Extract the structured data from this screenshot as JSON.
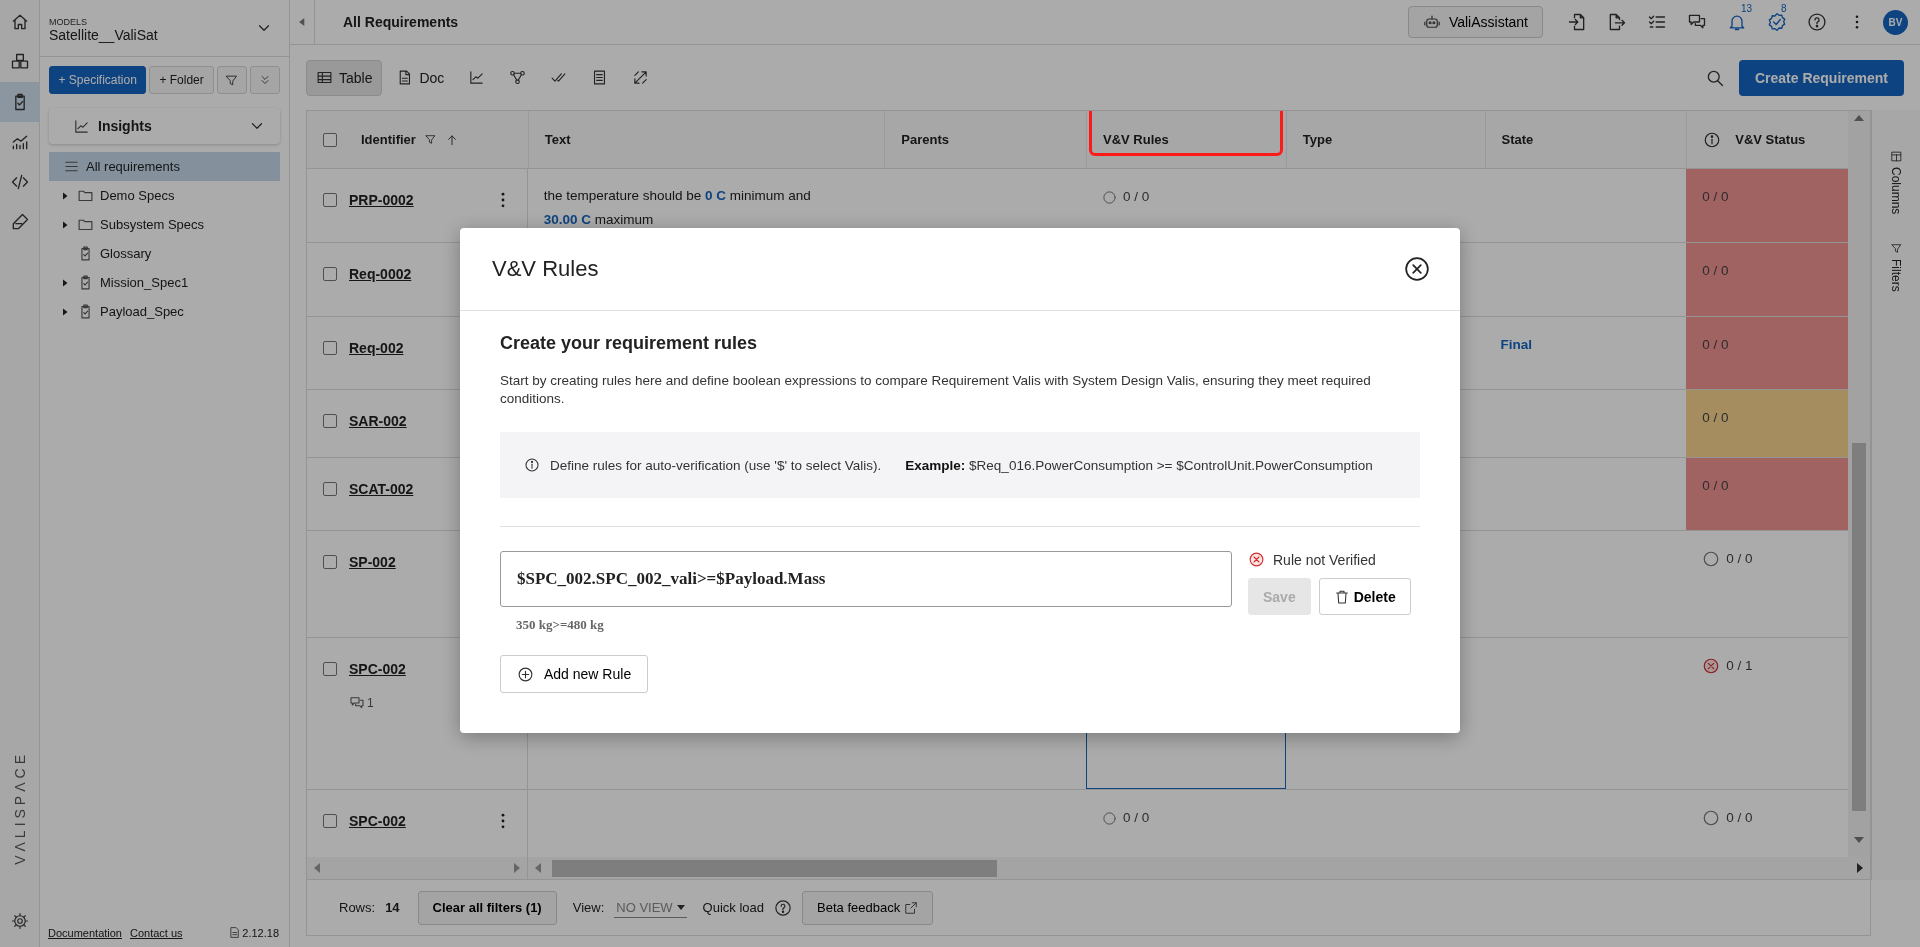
{
  "rail": {
    "items": [
      {
        "kind": "home",
        "selected": false
      },
      {
        "kind": "cubes",
        "selected": false
      },
      {
        "kind": "requirements",
        "selected": true
      },
      {
        "kind": "analytics",
        "selected": false
      },
      {
        "kind": "code",
        "selected": false
      },
      {
        "kind": "tools",
        "selected": false
      }
    ],
    "logo": "VΛLISPΛCE"
  },
  "sidebar": {
    "models_label": "MODELS",
    "model": "Satellite__ValiSat",
    "add_specification": "+ Specification",
    "add_folder": "+ Folder",
    "insights": "Insights",
    "tree": [
      {
        "label": "All requirements",
        "kind": "all",
        "selected": true
      },
      {
        "label": "Demo Specs",
        "kind": "folder",
        "selected": false,
        "expanded": false
      },
      {
        "label": "Subsystem Specs",
        "kind": "folder",
        "selected": false,
        "expanded": false
      },
      {
        "label": "Glossary",
        "kind": "spec",
        "selected": false
      },
      {
        "label": "Mission_Spec1",
        "kind": "spec",
        "selected": false,
        "expanded": false
      },
      {
        "label": "Payload_Spec",
        "kind": "spec",
        "selected": false,
        "expanded": false
      }
    ],
    "links": [
      "Documentation",
      "Contact us"
    ],
    "version": "2.12.18"
  },
  "topbar": {
    "title": "All Requirements",
    "assistant": "ValiAssistant",
    "notifications": "13",
    "tasks": "8",
    "avatar": "BV"
  },
  "toolbar": {
    "views": [
      {
        "kind": "table",
        "label": "Table",
        "selected": true
      },
      {
        "kind": "doc",
        "label": "Doc",
        "selected": false
      },
      {
        "kind": "chart",
        "selected": false
      },
      {
        "kind": "graph",
        "selected": false
      },
      {
        "kind": "verification",
        "selected": false
      },
      {
        "kind": "list",
        "selected": false
      },
      {
        "kind": "tools",
        "selected": false
      }
    ],
    "create": "Create Requirement"
  },
  "table": {
    "all_checked": false,
    "columns": [
      {
        "label": "Identifier",
        "kind": "identifier",
        "highlighted": false
      },
      {
        "label": "Text",
        "kind": "text",
        "highlighted": false
      },
      {
        "label": "Parents",
        "kind": "plain",
        "highlighted": false
      },
      {
        "label": "V&V Rules",
        "kind": "plain",
        "highlighted": true
      },
      {
        "label": "Type",
        "kind": "plain",
        "highlighted": false
      },
      {
        "label": "State",
        "kind": "plain",
        "highlighted": false
      },
      {
        "label": "V&V Status",
        "kind": "status",
        "highlighted": false
      }
    ],
    "rows": [
      {
        "identifier": "PRP-0002",
        "checked": false,
        "menu": true,
        "text": "the temperature should be **0  C** minimum and **30.00  C** maximum",
        "vv_rules": "0 / 0",
        "rules_selected": false,
        "status": {
          "kind": "fail",
          "value": "0 / 0"
        }
      },
      {
        "identifier": "Req-0002",
        "checked": false,
        "status": {
          "kind": "fail",
          "value": "0 / 0"
        }
      },
      {
        "identifier": "Req-002",
        "checked": false,
        "state": "Final",
        "status": {
          "kind": "fail",
          "value": "0 / 0"
        }
      },
      {
        "identifier": "SAR-002",
        "checked": false,
        "status": {
          "kind": "warn",
          "value": "0 / 0"
        }
      },
      {
        "identifier": "SCAT-002",
        "checked": false,
        "status": {
          "kind": "fail",
          "value": "0 / 0"
        }
      },
      {
        "identifier": "SP-002",
        "checked": false,
        "status": {
          "kind": "none",
          "value": "0 / 0"
        }
      },
      {
        "identifier": "SPC-002",
        "checked": false,
        "menu": false,
        "comments": "1",
        "rules_selected": true,
        "status": {
          "kind": "error",
          "value": "0 / 1"
        }
      },
      {
        "identifier": "SPC-002",
        "checked": false,
        "menu": true,
        "vv_rules": "0 / 0",
        "rules_selected": false,
        "status": {
          "kind": "none",
          "value": "0 / 0"
        }
      }
    ]
  },
  "footer": {
    "rows_label": "Rows:",
    "rows_count": "14",
    "clear": "Clear all filters (1)",
    "view_label": "View:",
    "view": "NO VIEW",
    "quick_load": "Quick load",
    "feedback": "Beta feedback"
  },
  "side_panel": [
    {
      "kind": "columns",
      "label": "Columns"
    },
    {
      "kind": "filters",
      "label": "Filters"
    }
  ],
  "dialog": {
    "title": "V&V Rules",
    "heading": "Create your requirement rules",
    "description": "Start by creating rules here and define boolean expressions to compare Requirement Valis with System Design Valis, ensuring they meet required conditions.",
    "hint": "Define rules for auto-verification (use '$' to select Valis).",
    "example": "**Example:** $Req_016.PowerConsumption >= $ControlUnit.PowerConsumption",
    "rules": [
      {
        "expression": "$SPC_002.SPC_002_vali>=$Payload.Mass",
        "evaluation": "350 kg>=480 kg",
        "verified": false,
        "status": "Rule not Verified",
        "save": "Save",
        "save_disabled": true,
        "delete": "Delete"
      }
    ],
    "add": "Add new Rule"
  }
}
